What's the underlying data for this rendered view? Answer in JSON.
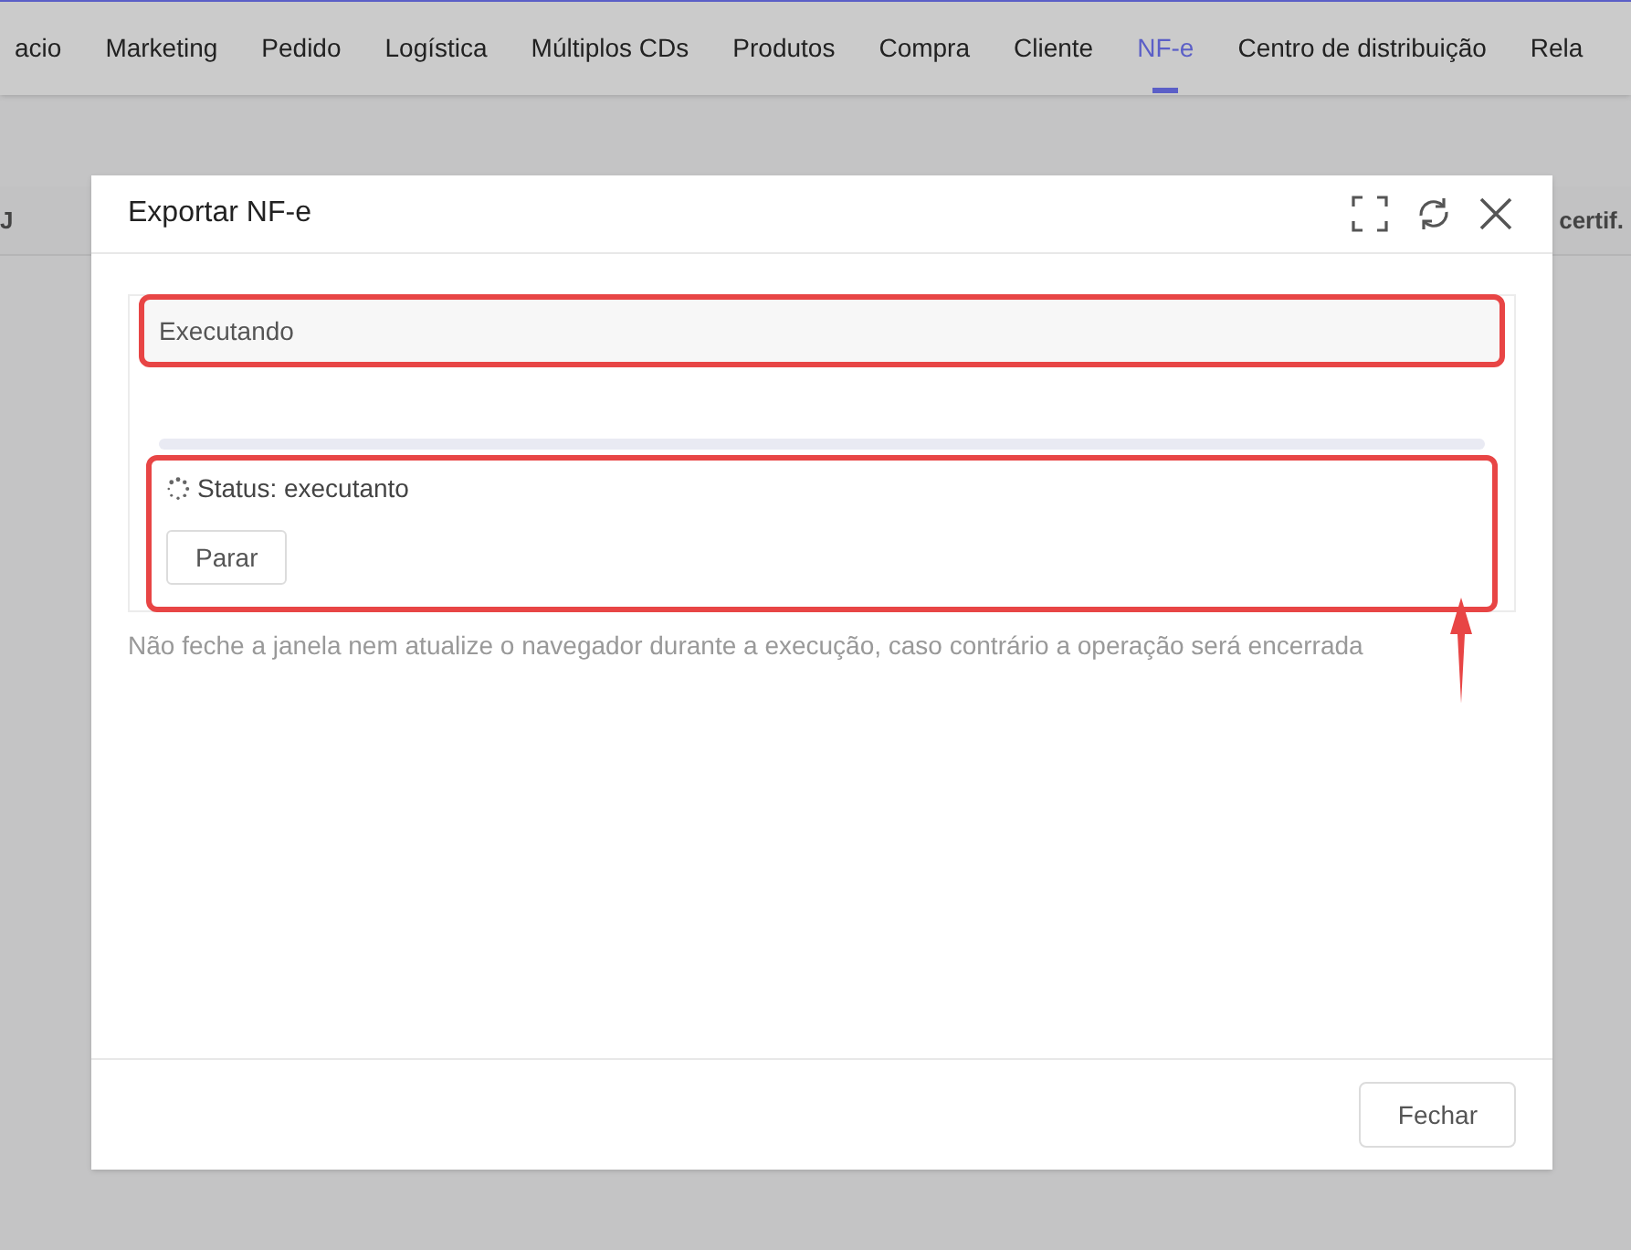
{
  "nav": {
    "tabs": [
      {
        "label": "acio",
        "selected": false
      },
      {
        "label": "Marketing",
        "selected": false
      },
      {
        "label": "Pedido",
        "selected": false
      },
      {
        "label": "Logística",
        "selected": false
      },
      {
        "label": "Múltiplos CDs",
        "selected": false
      },
      {
        "label": "Produtos",
        "selected": false
      },
      {
        "label": "Compra",
        "selected": false
      },
      {
        "label": "Cliente",
        "selected": false
      },
      {
        "label": "NF-e",
        "selected": true
      },
      {
        "label": "Centro de distribuição",
        "selected": false
      },
      {
        "label": "Rela",
        "selected": false
      }
    ]
  },
  "background_table": {
    "column_1": "J",
    "column_2": "certif."
  },
  "dialog": {
    "title": "Exportar NF-e",
    "task": {
      "header": "Executando",
      "header_highlighted": true,
      "status": "Status: executanto",
      "status_highlighted": true,
      "stop_button": "Parar"
    },
    "annotation_arrow": true,
    "warning": "Não feche a janela nem atualize o navegador durante a execução, caso contrário a operação será encerrada",
    "close_button": "Fechar"
  }
}
